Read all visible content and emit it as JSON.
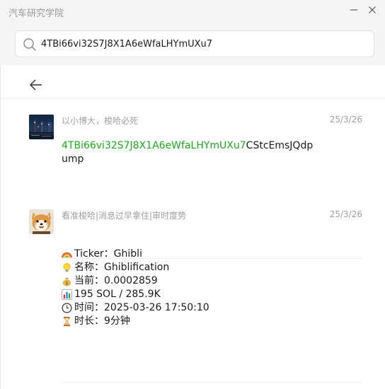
{
  "window": {
    "title": "汽车研究学院",
    "minimize_label": "—",
    "close_label": "✕"
  },
  "search": {
    "query": "4TBi66vi32S7J8X1A6eWfaLHYmUXu7",
    "icon": "search-icon"
  },
  "messages": [
    {
      "sender": "以小博大，梭哈必死",
      "date": "25/3/26",
      "highlight": "4TBi66vi32S7J8X1A6eWfaLHYmUXu7",
      "rest": "CStcEmsJQdpump"
    },
    {
      "sender": "看准梭哈|消息过早拿住|审时度势",
      "date": "25/3/26",
      "lines": [
        {
          "icon": "rainbow-icon",
          "text": "Ticker：Ghibli"
        },
        {
          "icon": "lightbulb-icon",
          "text": "名称：Ghiblification"
        },
        {
          "icon": "money-bag-icon",
          "text": "当前：0.0002859"
        },
        {
          "icon": "bar-chart-icon",
          "text": "195 SOL / 285.9K"
        },
        {
          "icon": "clock-icon",
          "text": "时间：2025-03-26 17:50:10"
        },
        {
          "icon": "hourglass-icon",
          "text": "时长：9分钟"
        }
      ]
    }
  ],
  "colors": {
    "highlight": "#1aad19",
    "meta_text": "#a0a0a0",
    "titlebar_bg": "#f5f5f5"
  }
}
